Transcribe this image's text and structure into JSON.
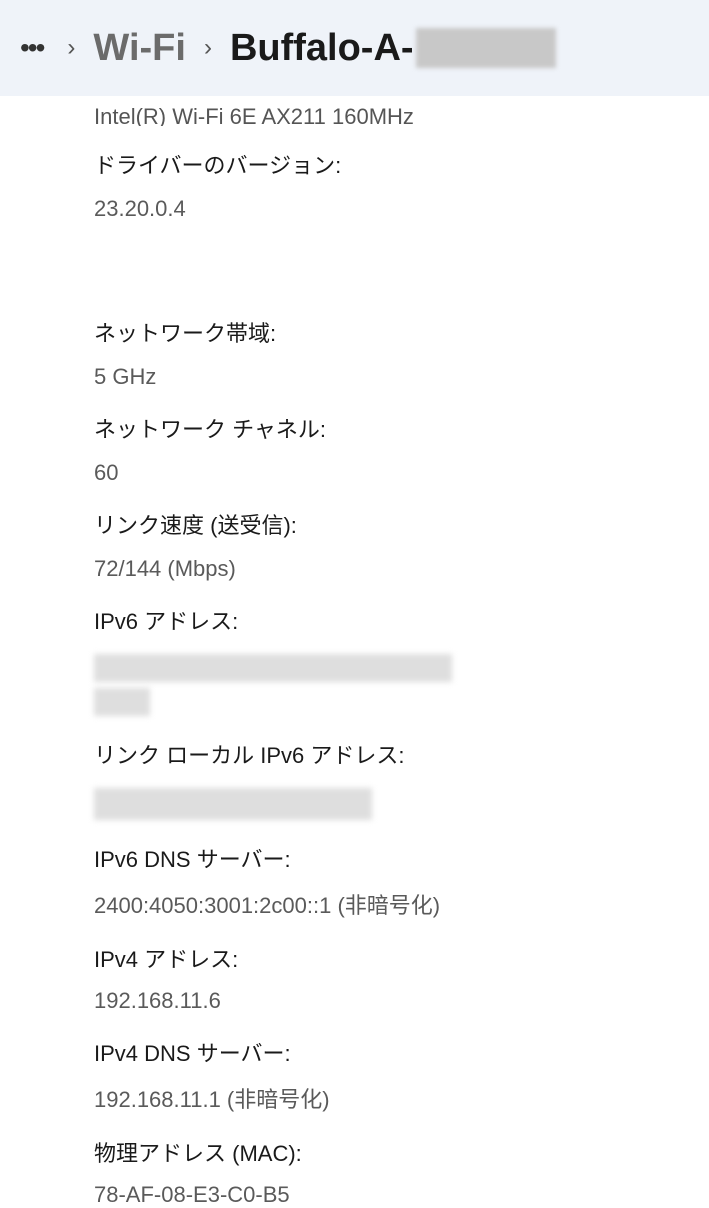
{
  "breadcrumb": {
    "wifi": "Wi-Fi",
    "network_name": "Buffalo-A-"
  },
  "props": {
    "adapter_cutoff": "Intel(R) Wi-Fi 6E AX211 160MHz",
    "driver_version_label": "ドライバーのバージョン:",
    "driver_version_value": "23.20.0.4",
    "band_label": "ネットワーク帯域:",
    "band_value": "5 GHz",
    "channel_label": "ネットワーク チャネル:",
    "channel_value": "60",
    "link_speed_label": "リンク速度 (送受信):",
    "link_speed_value": "72/144 (Mbps)",
    "ipv6_addr_label": "IPv6 アドレス:",
    "ipv6_ll_label": "リンク ローカル IPv6 アドレス:",
    "ipv6_dns_label": "IPv6 DNS サーバー:",
    "ipv6_dns_value": "2400:4050:3001:2c00::1 (非暗号化)",
    "ipv4_addr_label": "IPv4 アドレス:",
    "ipv4_addr_value": "192.168.11.6",
    "ipv4_dns_label": "IPv4 DNS サーバー:",
    "ipv4_dns_value": "192.168.11.1 (非暗号化)",
    "mac_label": "物理アドレス (MAC):",
    "mac_value": "78-AF-08-E3-C0-B5"
  }
}
